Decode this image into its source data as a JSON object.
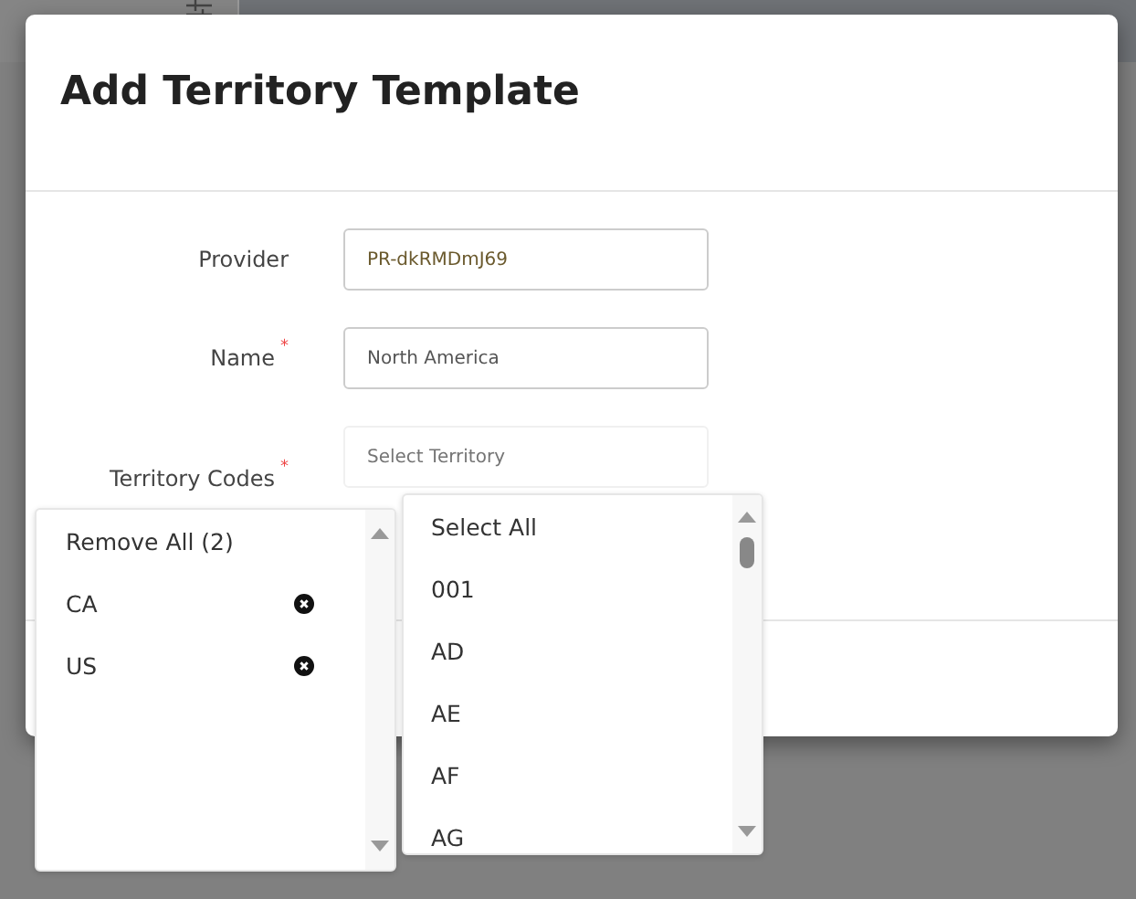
{
  "dialog": {
    "title": "Add Territory Template"
  },
  "fields": [
    {
      "kind": "text",
      "label": "Provider",
      "value": "PR-dkRMDmJ69"
    },
    {
      "kind": "text",
      "label": "Name",
      "required_mark": "*",
      "value": "North America"
    },
    {
      "kind": "select",
      "label": "Territory Codes",
      "required_mark": "*",
      "placeholder": "Select Territory"
    }
  ],
  "selected_panel": {
    "remove_all": "Remove All (2)",
    "items": [
      {
        "code": "CA"
      },
      {
        "code": "US"
      }
    ]
  },
  "options_panel": {
    "items": [
      "Select All",
      "001",
      "AD",
      "AE",
      "AF",
      "AG"
    ]
  }
}
